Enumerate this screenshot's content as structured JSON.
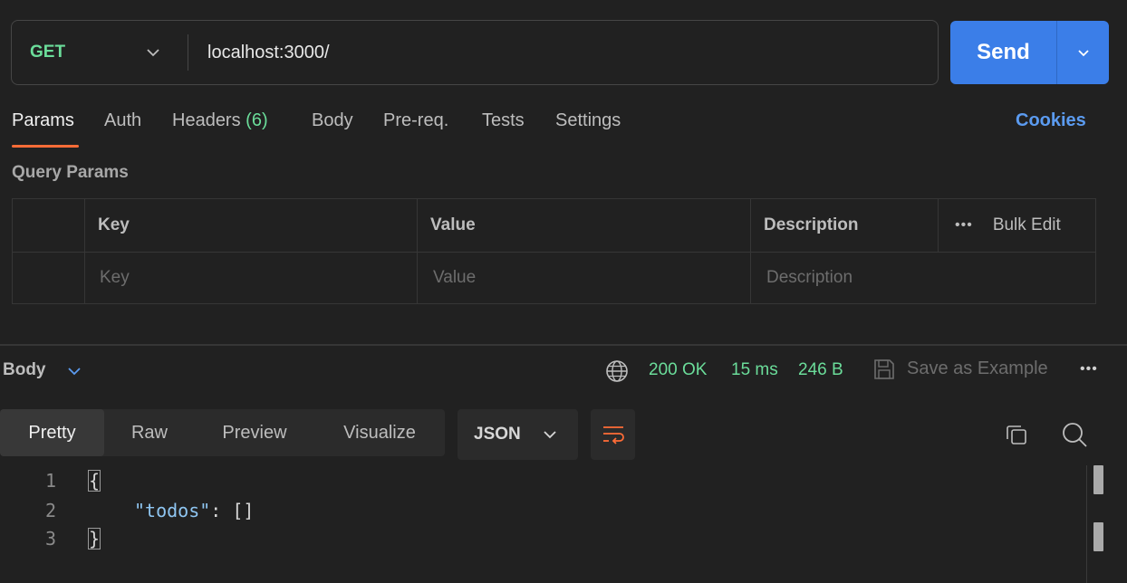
{
  "request": {
    "method": "GET",
    "url": "localhost:3000/",
    "send_label": "Send"
  },
  "tabs": {
    "params": "Params",
    "auth": "Auth",
    "headers": "Headers",
    "headers_count": "(6)",
    "body": "Body",
    "prereq": "Pre-req.",
    "tests": "Tests",
    "settings": "Settings",
    "cookies": "Cookies"
  },
  "query_params": {
    "title": "Query Params",
    "headers": [
      "Key",
      "Value",
      "Description"
    ],
    "bulk_edit": "Bulk Edit",
    "placeholders": {
      "key": "Key",
      "value": "Value",
      "description": "Description"
    }
  },
  "response": {
    "body_label": "Body",
    "status": "200 OK",
    "time": "15 ms",
    "size": "246 B",
    "save_example": "Save as Example",
    "view_tabs": [
      "Pretty",
      "Raw",
      "Preview",
      "Visualize"
    ],
    "format": "JSON",
    "code_lines": [
      {
        "num": "1",
        "text": "{"
      },
      {
        "num": "2",
        "key": "\"todos\"",
        "rest": ": []"
      },
      {
        "num": "3",
        "text": "}"
      }
    ]
  },
  "colors": {
    "method_green": "#6bdd9a",
    "send_blue": "#3b7ee8",
    "tab_accent": "#ff6c37",
    "link_blue": "#5b9bf0",
    "json_key": "#8fc6f2"
  },
  "icons": [
    "chevron-down-icon",
    "globe-icon",
    "save-icon",
    "more-icon",
    "wrap-icon",
    "copy-icon",
    "search-icon"
  ]
}
